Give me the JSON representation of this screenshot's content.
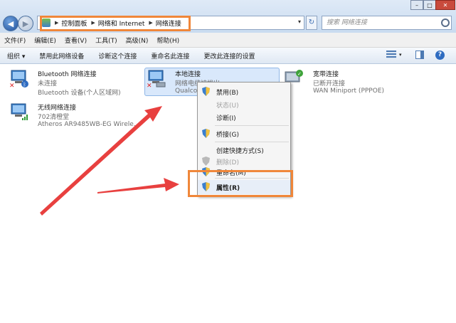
{
  "window": {
    "controls": {
      "min": "–",
      "max": "□",
      "close": "✕"
    }
  },
  "nav": {
    "back_icon": "arrow-left-icon",
    "forward_icon": "arrow-right-icon",
    "back": "◀",
    "forward": "▶"
  },
  "address": {
    "breadcrumbs": [
      "控制面板",
      "网络和 Internet",
      "网络连接"
    ],
    "sep": "▶",
    "drop": "▾",
    "refresh": "↻"
  },
  "search": {
    "placeholder": "搜索 网络连接"
  },
  "menubar": {
    "items": [
      "文件(F)",
      "编辑(E)",
      "查看(V)",
      "工具(T)",
      "高级(N)",
      "帮助(H)"
    ]
  },
  "toolbar": {
    "items": [
      "组织 ▾",
      "禁用此网络设备",
      "诊断这个连接",
      "重命名此连接",
      "更改此连接的设置"
    ],
    "view_drop": "▾",
    "help": "?"
  },
  "connections": [
    {
      "name": "Bluetooth 网络连接",
      "status": "未连接",
      "device": "Bluetooth 设备(个人区域网)"
    },
    {
      "name": "本地连接",
      "status": "网络电缆被拔出",
      "device": "Qualco"
    },
    {
      "name": "宽带连接",
      "status": "已断开连接",
      "device": "WAN Miniport (PPPOE)"
    },
    {
      "name": "无线网络连接",
      "status": "702清橙堂",
      "device": "Atheros AR9485WB-EG Wirele..."
    }
  ],
  "context_menu": {
    "items": [
      {
        "label": "禁用(B)",
        "shield": true,
        "disabled": false
      },
      {
        "label": "状态(U)",
        "shield": false,
        "disabled": true
      },
      {
        "label": "诊断(I)",
        "shield": false,
        "disabled": false
      },
      {
        "label": "桥接(G)",
        "shield": true,
        "disabled": false
      },
      {
        "label": "创建快捷方式(S)",
        "shield": false,
        "disabled": false
      },
      {
        "label": "删除(D)",
        "shield": true,
        "disabled": true
      },
      {
        "label": "重命名(M)",
        "shield": true,
        "disabled": false
      },
      {
        "label": "属性(R)",
        "shield": true,
        "disabled": false
      }
    ]
  },
  "colors": {
    "highlight": "#f0873a",
    "arrow": "#e8403f",
    "selection": "#d9e8fb"
  }
}
